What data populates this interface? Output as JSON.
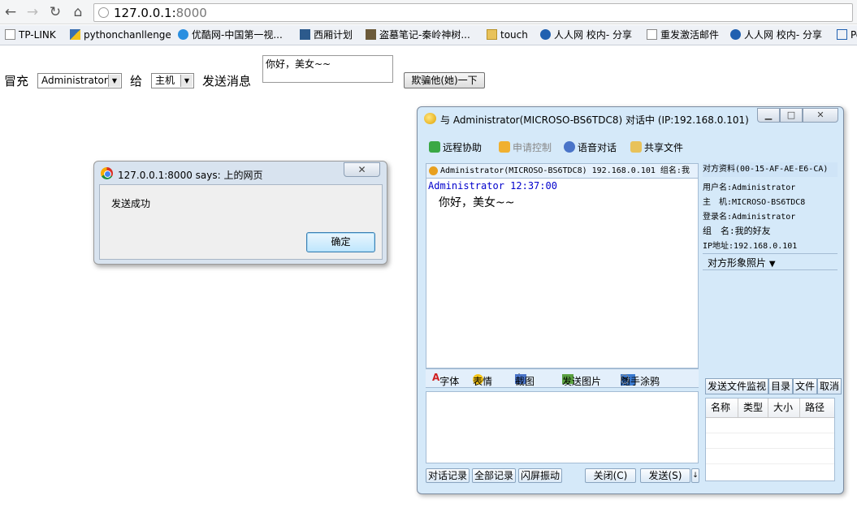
{
  "browser": {
    "url_host": "127.0.0.1:",
    "url_port": "8000",
    "bookmarks": [
      {
        "label": "TP-LINK",
        "icon": "page-icon"
      },
      {
        "label": "pythonchanllenge",
        "icon": "python-icon"
      },
      {
        "label": "优酷网-中国第一视...",
        "icon": "youku-icon"
      },
      {
        "label": "西厢计划",
        "icon": "ip-icon"
      },
      {
        "label": "盗墓笔记-秦岭神树...",
        "icon": "image-icon"
      },
      {
        "label": "touch",
        "icon": "folder-icon"
      },
      {
        "label": "人人网 校内- 分享",
        "icon": "renren-icon"
      },
      {
        "label": "重发激活邮件",
        "icon": "page-icon"
      },
      {
        "label": "人人网 校内- 分享",
        "icon": "renren-icon"
      },
      {
        "label": "Pe",
        "icon": "pe-icon"
      }
    ]
  },
  "form": {
    "impersonate_label": "冒充",
    "from_value": "Administrator",
    "to_label": "给",
    "to_value": "主机",
    "message_label": "发送消息",
    "message_value": "你好，美女~~",
    "submit_label": "欺骗他(她)一下"
  },
  "alert": {
    "title": "127.0.0.1:8000 says: 上的网页",
    "close": "✕",
    "message": "发送成功",
    "ok_label": "确定"
  },
  "qq": {
    "title": "与 Administrator(MICROSO-BS6TDC8) 对话中 (IP:192.168.0.101)",
    "toolbar": [
      "远程协助",
      "申请控制",
      "语音对话",
      "共享文件"
    ],
    "chat_header": "Administrator(MICROSO-BS6TDC8) 192.168.0.101 组名:我",
    "message_sender": "Administrator 12:37:00",
    "message_text": "你好，美女~~",
    "info_title": "对方资料(00-15-AF-AE-E6-CA)",
    "info_lines": [
      "用户名:Administrator",
      "主　机:MICROSO-BS6TDC8",
      "登录名:Administrator",
      "组　名:我的好友",
      "IP地址:192.168.0.101"
    ],
    "photo_label": "对方形象照片",
    "format_tools": [
      "字体",
      "表情",
      "截图",
      "发送图片",
      "随手涂鸦"
    ],
    "file_tabs": [
      "发送文件监视",
      "目录",
      "文件",
      "取消"
    ],
    "file_columns": [
      "名称",
      "类型",
      "大小",
      "路径"
    ],
    "bottom_buttons": [
      "对话记录",
      "全部记录",
      "闪屏振动",
      "关闭(C)",
      "发送(S)"
    ],
    "colors": {
      "frame": "#d5e9f9",
      "chat_blue": "#0000cc"
    }
  }
}
